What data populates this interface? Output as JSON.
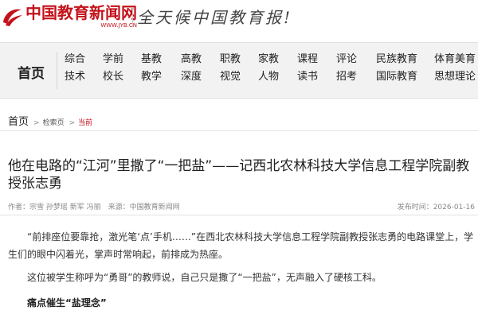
{
  "header": {
    "logo_text": "中国教育新闻网",
    "logo_url": "WWW.JYB.CN",
    "slogan": "全天候中国教育报!"
  },
  "nav": {
    "home": "首页",
    "columns": [
      [
        "综合",
        "技术"
      ],
      [
        "学前",
        "校长"
      ],
      [
        "基教",
        "教学"
      ],
      [
        "高教",
        "深度"
      ],
      [
        "职教",
        "视觉"
      ],
      [
        "家教",
        "人物"
      ],
      [
        "课程",
        "读书"
      ],
      [
        "评论",
        "招考"
      ],
      [
        "民族教育",
        "国际教育"
      ],
      [
        "体育美育",
        "思想理论"
      ]
    ]
  },
  "breadcrumb": {
    "home": "首页",
    "sep": ">",
    "section": "检索页",
    "current": "当前"
  },
  "article": {
    "title": "他在电路的“江河”里撒了“一把盐”——记西北农林科技大学信息工程学院副教授张志勇",
    "authors": "作者：宗雪 孙梦瑶 新军 冯丽　来源：中国教育新闻网",
    "publish": "发布时间：2026-01-16",
    "para1": "“前排座位要靠抢，激光笔‘点’手机……”在西北农林科技大学信息工程学院副教授张志勇的电路课堂上，学生们的眼中闪着光，掌声时常响起，前排成为热座。",
    "para2": "这位被学生称呼为“勇哥”的教师说，自己只是撒了“一把盐”，无声融入了硬核工科。",
    "subheading": "痛点催生“盐理念”"
  },
  "colors": {
    "brand_red": "#c4121b"
  }
}
